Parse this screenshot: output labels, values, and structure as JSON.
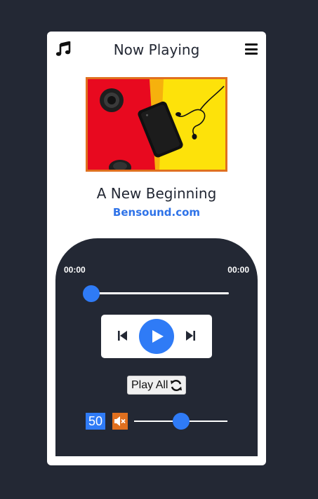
{
  "header": {
    "title": "Now Playing",
    "left_icon": "music-note-icon",
    "right_icon": "hamburger-menu-icon"
  },
  "track": {
    "title": "A New Beginning",
    "artist": "Bensound.com",
    "album_art": "headphones-and-phone-photo"
  },
  "player": {
    "current_time": "00:00",
    "total_time": "00:00",
    "progress": 0,
    "controls": {
      "prev_icon": "skip-previous-icon",
      "play_icon": "play-icon",
      "next_icon": "skip-next-icon"
    },
    "play_all_label": "Play All",
    "play_all_icon": "repeat-icon",
    "volume": 50,
    "volume_display": "50",
    "mute_icon": "volume-mute-icon"
  },
  "colors": {
    "accent": "#2f7bf6",
    "link": "#2f73e8",
    "mute": "#e0701f",
    "background": "#232834",
    "card": "#ffffff"
  }
}
